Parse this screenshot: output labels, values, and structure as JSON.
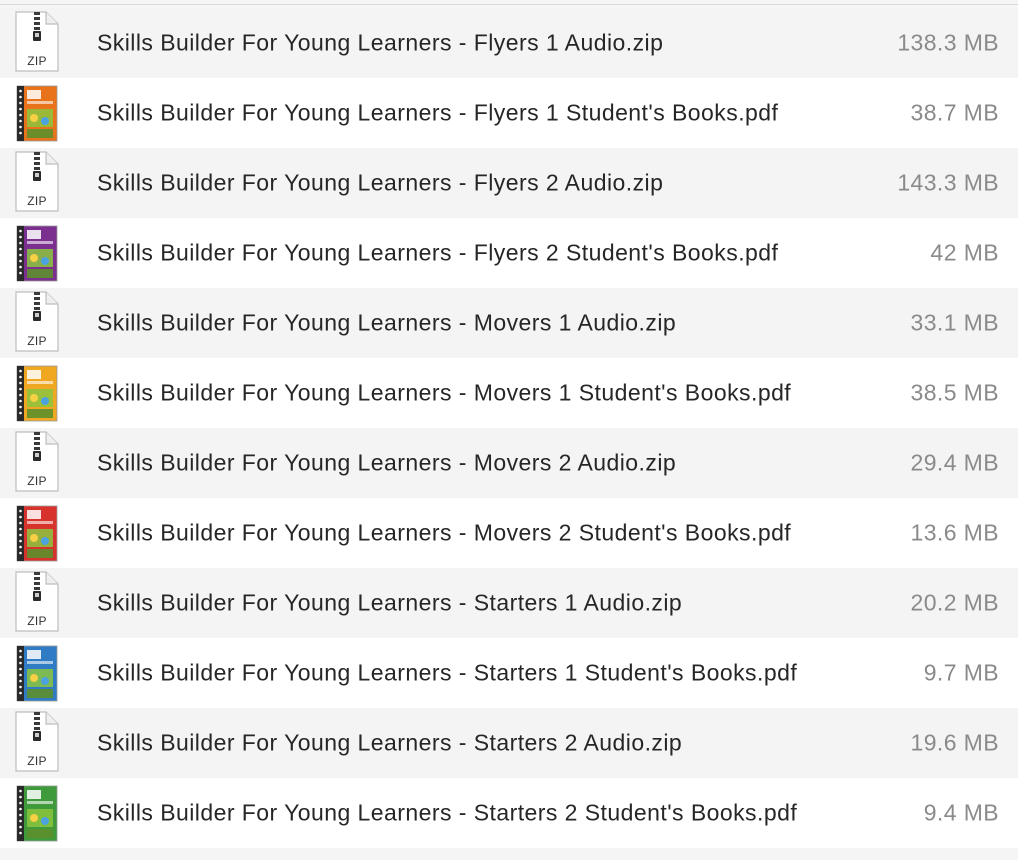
{
  "files": [
    {
      "name": "Skills Builder For Young Learners - Flyers 1 Audio.zip",
      "size": "138.3 MB",
      "icon": "zip-icon",
      "badge": "ZIP"
    },
    {
      "name": "Skills Builder For Young Learners - Flyers 1 Student's Books.pdf",
      "size": "38.7 MB",
      "icon": "pdf-book-icon",
      "color": "#e8731a"
    },
    {
      "name": "Skills Builder For Young Learners - Flyers 2 Audio.zip",
      "size": "143.3 MB",
      "icon": "zip-icon",
      "badge": "ZIP"
    },
    {
      "name": "Skills Builder For Young Learners - Flyers 2 Student's Books.pdf",
      "size": "42 MB",
      "icon": "pdf-book-icon",
      "color": "#7b2f8e"
    },
    {
      "name": "Skills Builder For Young Learners - Movers 1 Audio.zip",
      "size": "33.1 MB",
      "icon": "zip-icon",
      "badge": "ZIP"
    },
    {
      "name": "Skills Builder For Young Learners - Movers 1 Student's Books.pdf",
      "size": "38.5 MB",
      "icon": "pdf-book-icon",
      "color": "#f0a823"
    },
    {
      "name": "Skills Builder For Young Learners - Movers 2 Audio.zip",
      "size": "29.4 MB",
      "icon": "zip-icon",
      "badge": "ZIP"
    },
    {
      "name": "Skills Builder For Young Learners - Movers 2 Student's Books.pdf",
      "size": "13.6 MB",
      "icon": "pdf-book-icon",
      "color": "#d8322c"
    },
    {
      "name": "Skills Builder For Young Learners - Starters 1 Audio.zip",
      "size": "20.2 MB",
      "icon": "zip-icon",
      "badge": "ZIP"
    },
    {
      "name": "Skills Builder For Young Learners - Starters 1 Student's Books.pdf",
      "size": "9.7 MB",
      "icon": "pdf-book-icon",
      "color": "#2f7cc4"
    },
    {
      "name": "Skills Builder For Young Learners - Starters 2 Audio.zip",
      "size": "19.6 MB",
      "icon": "zip-icon",
      "badge": "ZIP"
    },
    {
      "name": "Skills Builder For Young Learners - Starters 2 Student's Books.pdf",
      "size": "9.4 MB",
      "icon": "pdf-book-icon",
      "color": "#3e9a3a"
    }
  ],
  "colors": {
    "row_alt": "#f4f4f5",
    "row": "#ffffff",
    "name_text": "#262626",
    "size_text": "#8a8a8a"
  }
}
